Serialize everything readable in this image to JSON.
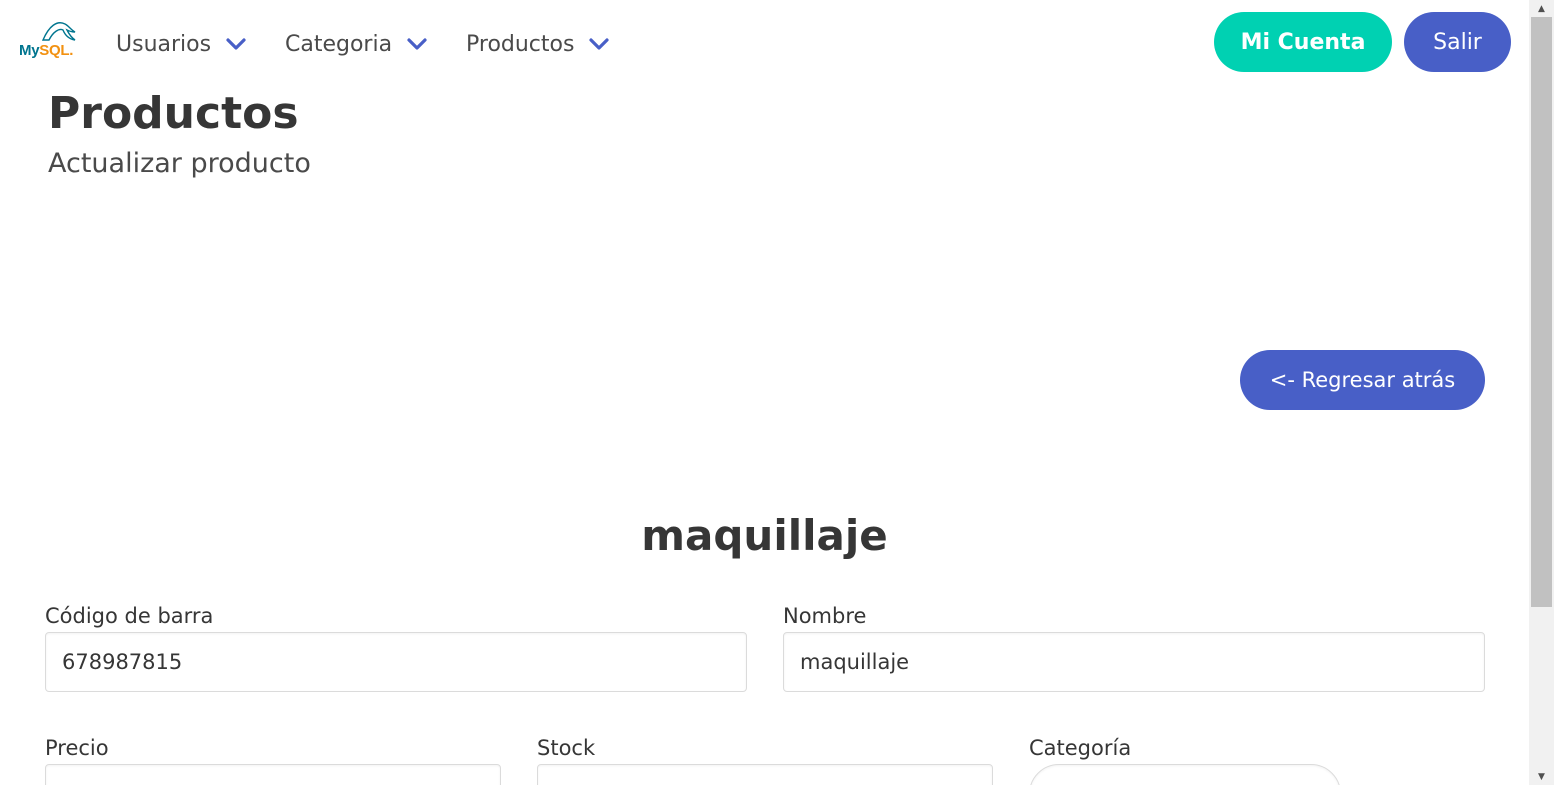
{
  "navbar": {
    "logo": {
      "my": "My",
      "sql": "SQL",
      "suffix": "."
    },
    "menu": [
      {
        "label": "Usuarios",
        "icon": "chevron-down-icon"
      },
      {
        "label": "Categoria",
        "icon": "chevron-down-icon"
      },
      {
        "label": "Productos",
        "icon": "chevron-down-icon"
      }
    ],
    "account_label": "Mi Cuenta",
    "exit_label": "Salir"
  },
  "header": {
    "title": "Productos",
    "subtitle": "Actualizar producto",
    "back_label": "<- Regresar atrás"
  },
  "form": {
    "product_name": "maquillaje",
    "barcode": {
      "label": "Código de barra",
      "value": "678987815"
    },
    "name": {
      "label": "Nombre",
      "value": "maquillaje"
    },
    "price": {
      "label": "Precio",
      "value": ""
    },
    "stock": {
      "label": "Stock",
      "value": ""
    },
    "category": {
      "label": "Categoría",
      "value": ""
    }
  },
  "colors": {
    "primary": "#485fc7",
    "accent": "#00d1b2",
    "text": "#363636"
  }
}
